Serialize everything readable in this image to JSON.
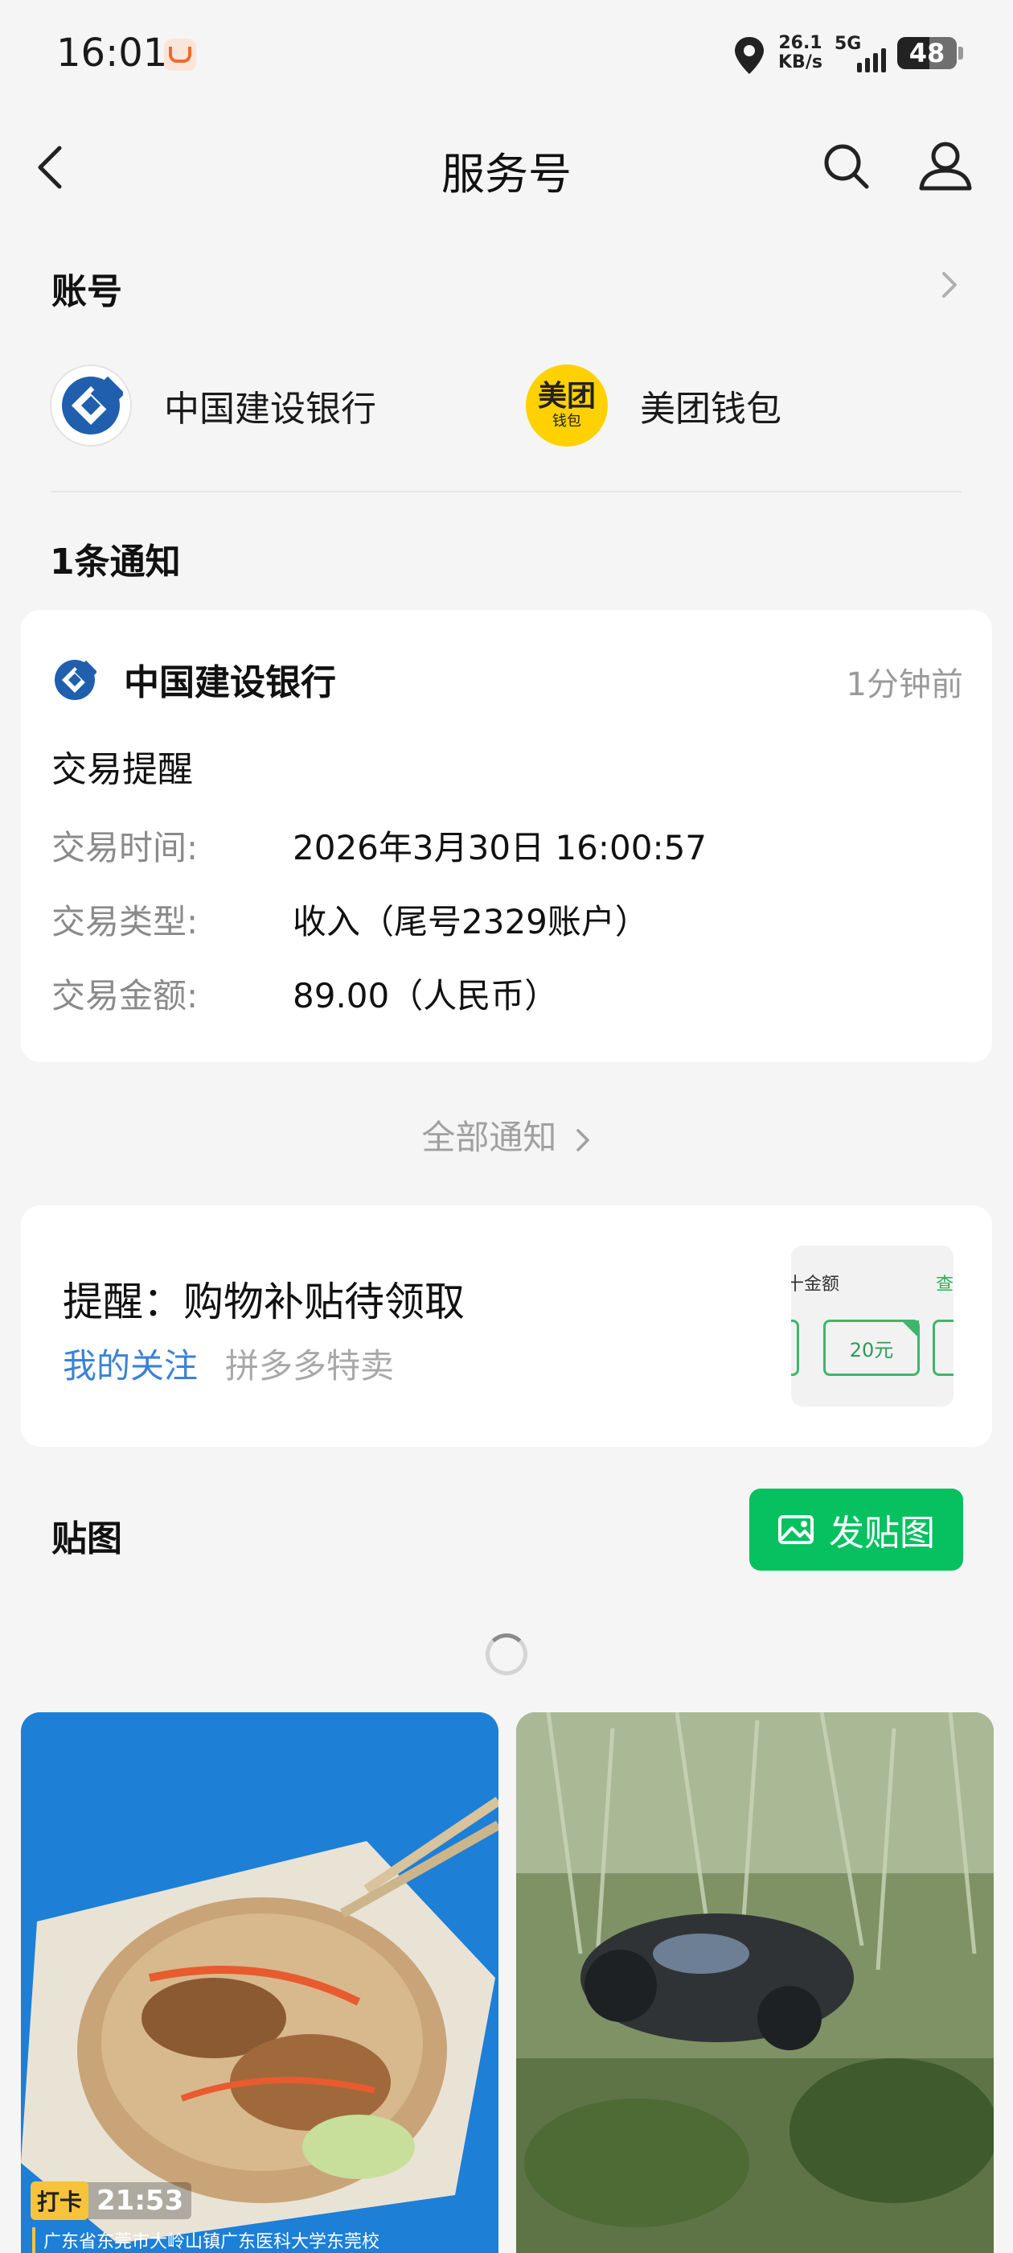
{
  "status_bar": {
    "time": "16:01",
    "net_speed_value": "26.1",
    "net_speed_unit": "KB/s",
    "network_type": "5G",
    "battery": "48",
    "icons": [
      "didi-notification-icon",
      "location-icon",
      "signal-icon",
      "battery-icon"
    ]
  },
  "nav": {
    "title": "服务号",
    "icons": [
      "back-icon",
      "search-icon",
      "user-icon"
    ]
  },
  "accounts": {
    "heading": "账号",
    "items": [
      {
        "name": "中国建设银行",
        "logo": "ccb-logo"
      },
      {
        "name": "美团钱包",
        "logo_line1": "美团",
        "logo_line2": "钱包"
      }
    ]
  },
  "notifications": {
    "count_label": "1条通知",
    "card": {
      "sender": "中国建设银行",
      "time": "1分钟前",
      "type": "交易提醒",
      "rows": [
        {
          "key": "交易时间:",
          "value": "2026年3月30日 16:00:57"
        },
        {
          "key": "交易类型:",
          "value": "收入（尾号2329账户）"
        },
        {
          "key": "交易金额:",
          "value": "89.00（人民币）"
        }
      ]
    },
    "all_label": "全部通知"
  },
  "reminder": {
    "title": "提醒：购物补贴待领取",
    "follow_label": "我的关注",
    "source": "拼多多特卖",
    "thumb_text_left": "十金额",
    "thumb_text_right": "查",
    "thumb_coupon": "20元"
  },
  "tiezi": {
    "heading": "贴图",
    "post_button": "发贴图"
  },
  "photos": [
    {
      "stamp_tag": "打卡",
      "stamp_time": "21:53",
      "location": "广东省东莞市大岭山镇广东医科大学东莞校"
    },
    {}
  ],
  "colors": {
    "accent_green": "#07c160",
    "link_blue": "#3b82d6",
    "ccb_blue": "#1f5fae",
    "meituan_yellow": "#ffd100"
  }
}
